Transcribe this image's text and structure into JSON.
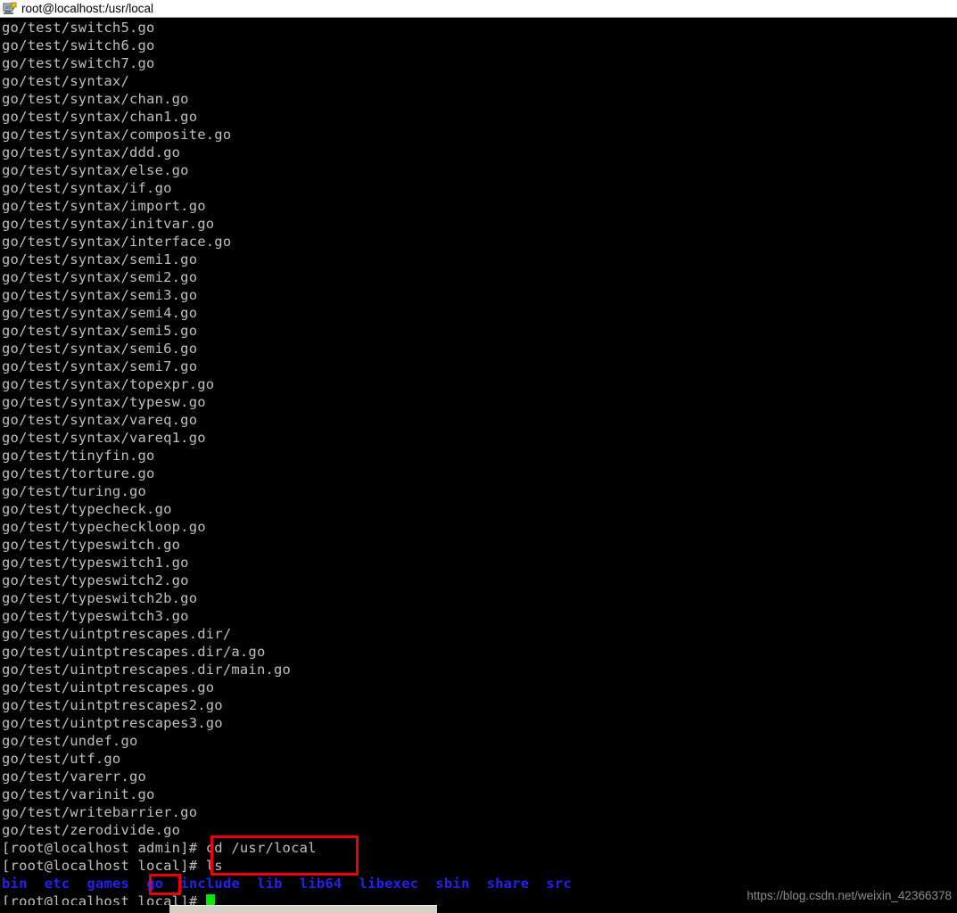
{
  "titlebar": {
    "title": "root@localhost:/usr/local",
    "icon": "putty-terminal-icon"
  },
  "terminal": {
    "colors": {
      "background": "#000000",
      "foreground": "#bfbfbf",
      "directory_blue": "#2222ee",
      "cursor_green": "#00e800",
      "annotation_red": "#ee0000"
    },
    "output_lines": [
      "go/test/switch5.go",
      "go/test/switch6.go",
      "go/test/switch7.go",
      "go/test/syntax/",
      "go/test/syntax/chan.go",
      "go/test/syntax/chan1.go",
      "go/test/syntax/composite.go",
      "go/test/syntax/ddd.go",
      "go/test/syntax/else.go",
      "go/test/syntax/if.go",
      "go/test/syntax/import.go",
      "go/test/syntax/initvar.go",
      "go/test/syntax/interface.go",
      "go/test/syntax/semi1.go",
      "go/test/syntax/semi2.go",
      "go/test/syntax/semi3.go",
      "go/test/syntax/semi4.go",
      "go/test/syntax/semi5.go",
      "go/test/syntax/semi6.go",
      "go/test/syntax/semi7.go",
      "go/test/syntax/topexpr.go",
      "go/test/syntax/typesw.go",
      "go/test/syntax/vareq.go",
      "go/test/syntax/vareq1.go",
      "go/test/tinyfin.go",
      "go/test/torture.go",
      "go/test/turing.go",
      "go/test/typecheck.go",
      "go/test/typecheckloop.go",
      "go/test/typeswitch.go",
      "go/test/typeswitch1.go",
      "go/test/typeswitch2.go",
      "go/test/typeswitch2b.go",
      "go/test/typeswitch3.go",
      "go/test/uintptrescapes.dir/",
      "go/test/uintptrescapes.dir/a.go",
      "go/test/uintptrescapes.dir/main.go",
      "go/test/uintptrescapes.go",
      "go/test/uintptrescapes2.go",
      "go/test/uintptrescapes3.go",
      "go/test/undef.go",
      "go/test/utf.go",
      "go/test/varerr.go",
      "go/test/varinit.go",
      "go/test/writebarrier.go",
      "go/test/zerodivide.go"
    ],
    "prompt_cd": {
      "prompt": "[root@localhost admin]# ",
      "command": "cd /usr/local"
    },
    "prompt_ls": {
      "prompt": "[root@localhost local]# ",
      "command": "ls"
    },
    "ls_output": [
      "bin",
      "etc",
      "games",
      "go",
      "include",
      "lib",
      "lib64",
      "libexec",
      "sbin",
      "share",
      "src"
    ],
    "prompt_final": {
      "prompt": "[root@localhost local]# ",
      "cursor": "block"
    }
  },
  "annotations": {
    "commands_box_label": "highlight-commands",
    "go_box_label": "highlight-go-directory"
  },
  "watermark": {
    "text": "https://blog.csdn.net/weixin_42366378"
  }
}
